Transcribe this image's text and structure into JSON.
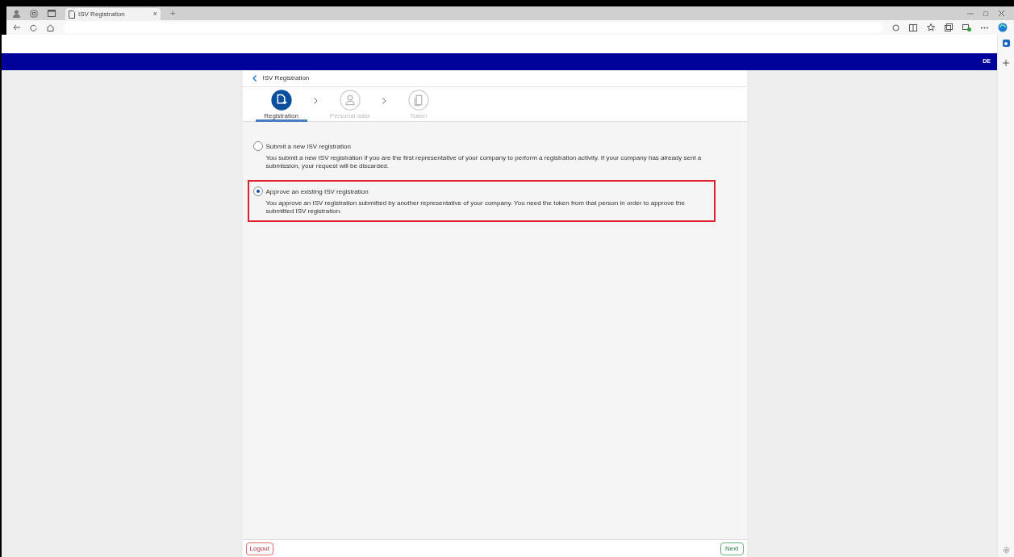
{
  "browser": {
    "tab_title": "ISV Registration",
    "tab_close": "×",
    "new_tab": "+"
  },
  "header": {
    "language": "DE"
  },
  "page": {
    "title": "ISV Registration"
  },
  "steps": [
    {
      "label": "Registration",
      "selected": true,
      "kind": "document"
    },
    {
      "label": "Personal data",
      "selected": false,
      "kind": "person"
    },
    {
      "label": "Token",
      "selected": false,
      "kind": "copy"
    }
  ],
  "options": [
    {
      "title": "Submit a new ISV registration",
      "description": "You submit a new ISV registration if you are the first representative of your company to perform a registration activity. If your company has already sent a submission, your request will be discarded.",
      "selected": false,
      "highlighted": false
    },
    {
      "title": "Approve an existing ISV registration",
      "description": "You approve an ISV registration submitted by another representative of your company. You need the token from that person in order to approve the submitted ISV registration.",
      "selected": true,
      "highlighted": true
    }
  ],
  "footer": {
    "logout": "Logout",
    "next": "Next"
  }
}
